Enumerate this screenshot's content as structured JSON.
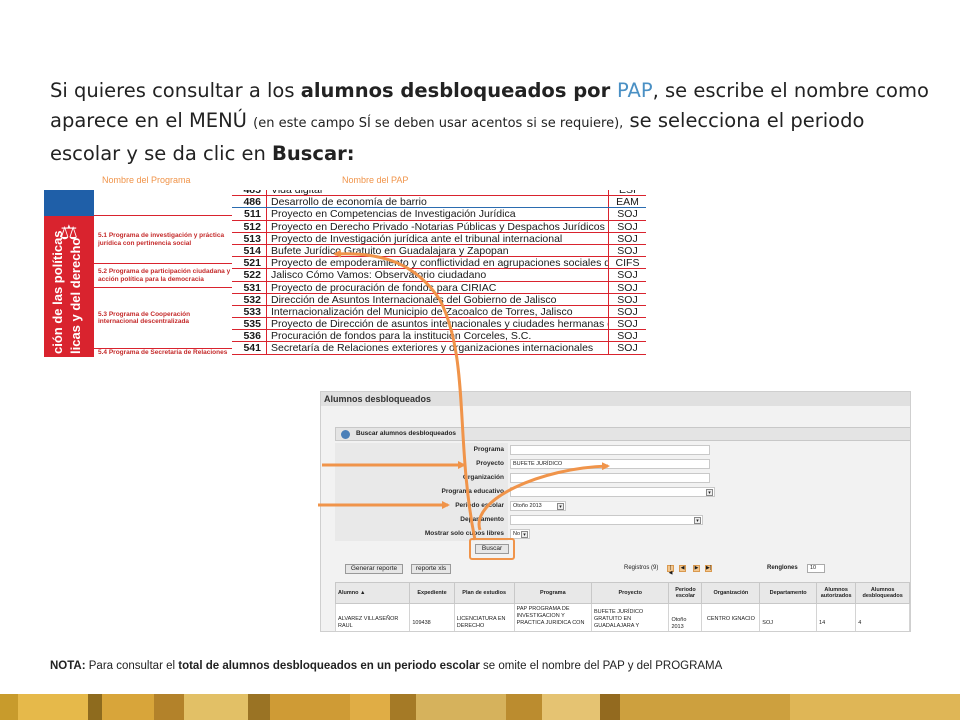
{
  "headline": {
    "p1": "Si quieres consultar a los ",
    "p2": "alumnos desbloqueados por ",
    "p3": "PAP",
    "p4": ", se escribe el nombre como aparece en el MENÚ ",
    "p5": "(en este campo SÍ se deben usar acentos si se requiere),",
    "p6": " se selecciona el periodo escolar y se da clic en ",
    "p7": "Buscar:"
  },
  "catalog": {
    "header_program": "Nombre del Programa",
    "header_pap": "Nombre del PAP",
    "band_text_line1": "ción de las políticas",
    "band_text_line2": "licas y del derecho",
    "programs": [
      {
        "label": "5.1 Programa de investigación y práctica jurídica con pertinencia social"
      },
      {
        "label": "5.2 Programa de participación ciudadana y acción política para la democracia"
      },
      {
        "label": "5.3 Programa de Cooperación internacional descentralizada"
      },
      {
        "label": "5.4 Programa de Secretaría de Relaciones"
      }
    ],
    "rows": [
      {
        "num": "485",
        "name": "Vida digital",
        "dep": "ESI"
      },
      {
        "num": "486",
        "name": "Desarrollo de economía de barrio",
        "dep": "EAM"
      },
      {
        "num": "511",
        "name": "Proyecto en Competencias de Investigación Jurídica",
        "dep": "SOJ"
      },
      {
        "num": "512",
        "name": "Proyecto en Derecho Privado -Notarias Públicas y Despachos Jurídicos",
        "dep": "SOJ"
      },
      {
        "num": "513",
        "name": "Proyecto de Investigación jurídica ante el tribunal internacional",
        "dep": "SOJ"
      },
      {
        "num": "514",
        "name": "Bufete Jurídico Gratuito en Guadalajara y Zapopan",
        "dep": "SOJ"
      },
      {
        "num": "521",
        "name": "Proyecto de empoderamiento y conflictividad en agrupaciones sociales de la ZMG",
        "dep": "CIFS"
      },
      {
        "num": "522",
        "name": "Jalisco Cómo Vamos: Observatorio ciudadano",
        "dep": "SOJ"
      },
      {
        "num": "531",
        "name": "Proyecto de procuración de fondos para CIRIAC",
        "dep": "SOJ"
      },
      {
        "num": "532",
        "name": "Dirección de Asuntos Internacionales del Gobierno de Jalisco",
        "dep": "SOJ"
      },
      {
        "num": "533",
        "name": "Internacionalización del Municipio de Zacoalco de Torres, Jalisco",
        "dep": "SOJ"
      },
      {
        "num": "535",
        "name": "Proyecto de Dirección de asuntos internacionales y ciudades hermanas de Zapopan",
        "dep": "SOJ"
      },
      {
        "num": "536",
        "name": "Procuración de fondos para la institución Corceles, S.C.",
        "dep": "SOJ"
      },
      {
        "num": "541",
        "name": "Secretaría de Relaciones exteriores y organizaciones internacionales",
        "dep": "SOJ"
      }
    ]
  },
  "system": {
    "title": "Alumnos desbloqueados",
    "panel_title": "Buscar alumnos desbloqueados",
    "fields": {
      "programa": {
        "label": "Programa",
        "value": ""
      },
      "proyecto": {
        "label": "Proyecto",
        "value": "BUFETE JURÍDICO"
      },
      "organizacion": {
        "label": "Organización",
        "value": ""
      },
      "programa_educativo": {
        "label": "Programa educativo",
        "value": ""
      },
      "periodo": {
        "label": "Periodo escolar",
        "value": "Otoño 2013"
      },
      "departamento": {
        "label": "Departamento",
        "value": ""
      },
      "cupos": {
        "label": "Mostrar solo cupos libres",
        "value": "No"
      }
    },
    "buscar": "Buscar",
    "generar": "Generar reporte",
    "reporte_xls": "reporte xls",
    "registros": "Registros (9)",
    "renglones": "Renglones",
    "renglones_value": "10",
    "nav": [
      "|◀",
      "◀",
      "▶",
      "▶|"
    ],
    "columns": [
      "Alumno ▲",
      "Expediente",
      "Plan de estudios",
      "Programa",
      "Proyecto",
      "Periodo escolar",
      "Organización",
      "Departamento",
      "Alumnos autorizados",
      "Alumnos desbloqueados"
    ],
    "row": [
      "ALVAREZ VILLASEÑOR RAUL",
      "109438",
      "LICENCIATURA EN DERECHO",
      "PAP PROGRAMA DE INVESTIGACION Y PRACTICA JURIDICA CON",
      "BUFETE JURÍDICO GRATUITO EN GUADALAJARA Y",
      "Otoño 2013",
      "CENTRO IGNACIO",
      "SOJ",
      "14",
      "4"
    ]
  },
  "note": {
    "n1": "NOTA:",
    "n2": " Para consultar el ",
    "n3": "total de alumnos desbloqueados en un periodo escolar",
    "n4": " se omite el nombre del PAP y del PROGRAMA"
  },
  "colors": {
    "accent": "#4a90c4",
    "arrow": "#f0944a",
    "catalog_red": "#d9232e",
    "catalog_blue": "#1f5fa8"
  },
  "stripe_colors": [
    "#c89b2c",
    "#e6b94a",
    "#8e6b1e",
    "#d8a53a",
    "#b3822a",
    "#e2c066",
    "#9a7324",
    "#cf9b35",
    "#e0ad45",
    "#a57a26",
    "#d6b25c",
    "#bb8c2f",
    "#e5c372",
    "#936a1f",
    "#cda03e",
    "#dfb656"
  ]
}
